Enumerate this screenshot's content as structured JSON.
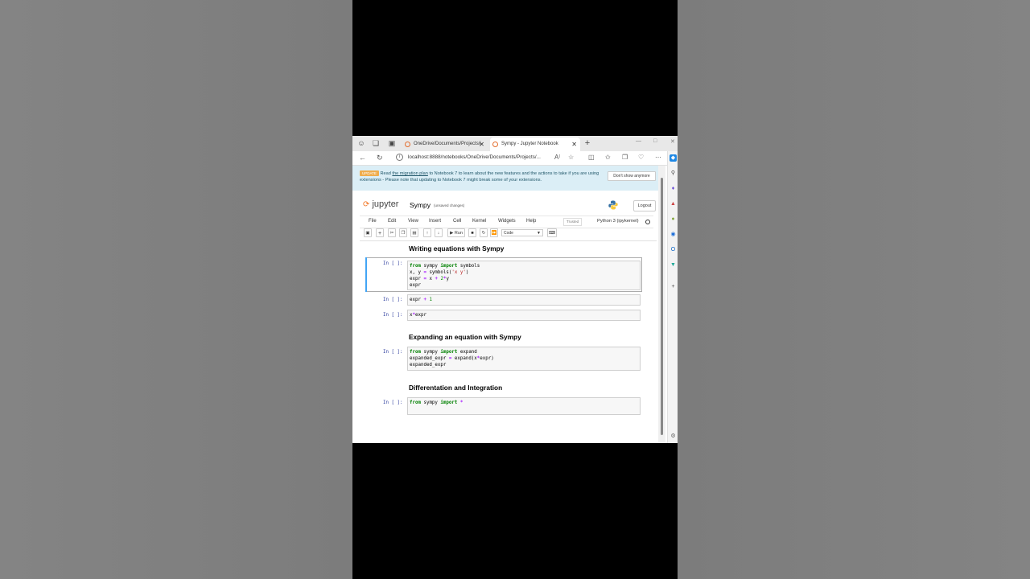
{
  "browser": {
    "tabs": [
      {
        "label": "OneDrive/Documents/Projects/j",
        "active": false
      },
      {
        "label": "Sympy - Jupyter Notebook",
        "active": true
      }
    ],
    "url": "localhost:8888/notebooks/OneDrive/Documents/Projects/..."
  },
  "banner": {
    "badge": "UPDATE",
    "text_before": "Read ",
    "link": "the migration plan",
    "text_after": " to Notebook 7 to learn about the new features and the actions to take if you are using extensions - Please note that updating to Notebook 7 might break some of your extensions.",
    "dismiss": "Don't show anymore"
  },
  "header": {
    "logo_text": "jupyter",
    "notebook_name": "Sympy",
    "save_status": "(unsaved changes)",
    "logout": "Logout"
  },
  "menubar": {
    "items": [
      "File",
      "Edit",
      "View",
      "Insert",
      "Cell",
      "Kernel",
      "Widgets",
      "Help"
    ],
    "trusted": "Trusted",
    "kernel": "Python 3 (ipykernel)"
  },
  "toolbar": {
    "run_label": "Run",
    "cell_type": "Code"
  },
  "notebook": {
    "headings": [
      "Writing equations with Sympy",
      "Expanding an equation with Sympy",
      "Differentation and Integration"
    ],
    "prompt": "In [ ]:"
  }
}
